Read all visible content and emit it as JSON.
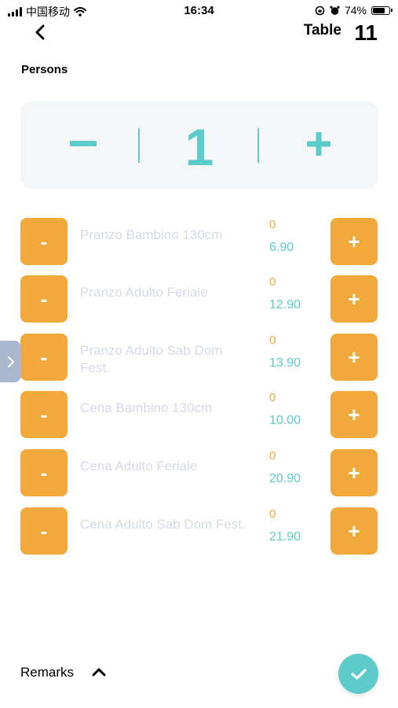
{
  "status_bar": {
    "carrier": "中国移动",
    "time": "16:34",
    "battery_percent": "74%",
    "battery_level": 0.74,
    "icons": [
      "signal-icon",
      "wifi-icon",
      "orientation-lock-icon",
      "alarm-icon",
      "battery-icon"
    ]
  },
  "header": {
    "table_label": "Table",
    "table_number": "11"
  },
  "persons": {
    "label": "Persons",
    "value": "1",
    "minus_symbol": "−",
    "plus_symbol": "+"
  },
  "items": [
    {
      "name": "Pranzo Bambino 130cm",
      "qty": "0",
      "price": "6.90",
      "minus": "-",
      "plus": "+"
    },
    {
      "name": "Pranzo Adulto Feriale",
      "qty": "0",
      "price": "12.90",
      "minus": "-",
      "plus": "+"
    },
    {
      "name": "Pranzo Adulto Sab Dom Fest.",
      "qty": "0",
      "price": "13.90",
      "minus": "-",
      "plus": "+"
    },
    {
      "name": "Cena Bambino 130cm",
      "qty": "0",
      "price": "10.00",
      "minus": "-",
      "plus": "+"
    },
    {
      "name": "Cena Adulto Feriale",
      "qty": "0",
      "price": "20.90",
      "minus": "-",
      "plus": "+"
    },
    {
      "name": "Cena Adulto Sab Dom Fest.",
      "qty": "0",
      "price": "21.90",
      "minus": "-",
      "plus": "+"
    }
  ],
  "footer": {
    "remarks_label": "Remarks"
  },
  "colors": {
    "accent_orange": "#f2a93b",
    "accent_teal": "#5ecbcb",
    "item_text": "#d6dae6",
    "side_tab": "#a9b7cf"
  }
}
